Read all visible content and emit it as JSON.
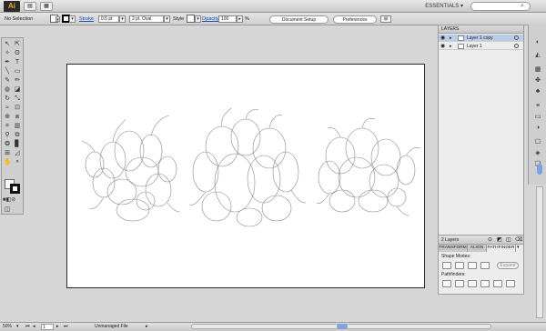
{
  "app": {
    "logo": "Ai",
    "workspace": "ESSENTIALS ▾"
  },
  "control_bar": {
    "selection": "No Selection",
    "stroke_label": "Stroke",
    "stroke_weight": "0.5 pt",
    "brush": "2 pt. Oval",
    "style_label": "Style",
    "opacity_label": "Opacity",
    "opacity_value": "100",
    "opacity_unit": "%",
    "document_setup": "Document Setup",
    "preferences": "Preferences"
  },
  "layers_panel": {
    "title": "LAYERS",
    "layers": [
      {
        "name": "Layer 1 copy"
      },
      {
        "name": "Layer 1"
      }
    ],
    "count": "2 Layers"
  },
  "pathfinder_panel": {
    "tabs": [
      "TRANSFORM",
      "ALIGN",
      "PATHFINDER"
    ],
    "shape_modes_label": "Shape Modes:",
    "pathfinders_label": "Pathfinders:",
    "expand_label": "Expand"
  },
  "status_bar": {
    "zoom": "50%",
    "artboard_num": "1",
    "status_text": "Unmanaged File"
  },
  "colors": {
    "accent": "#1b4fb5",
    "logo_bg": "#2b2b2b",
    "logo_fg": "#f5a623",
    "selected_row": "#b9cde8"
  }
}
